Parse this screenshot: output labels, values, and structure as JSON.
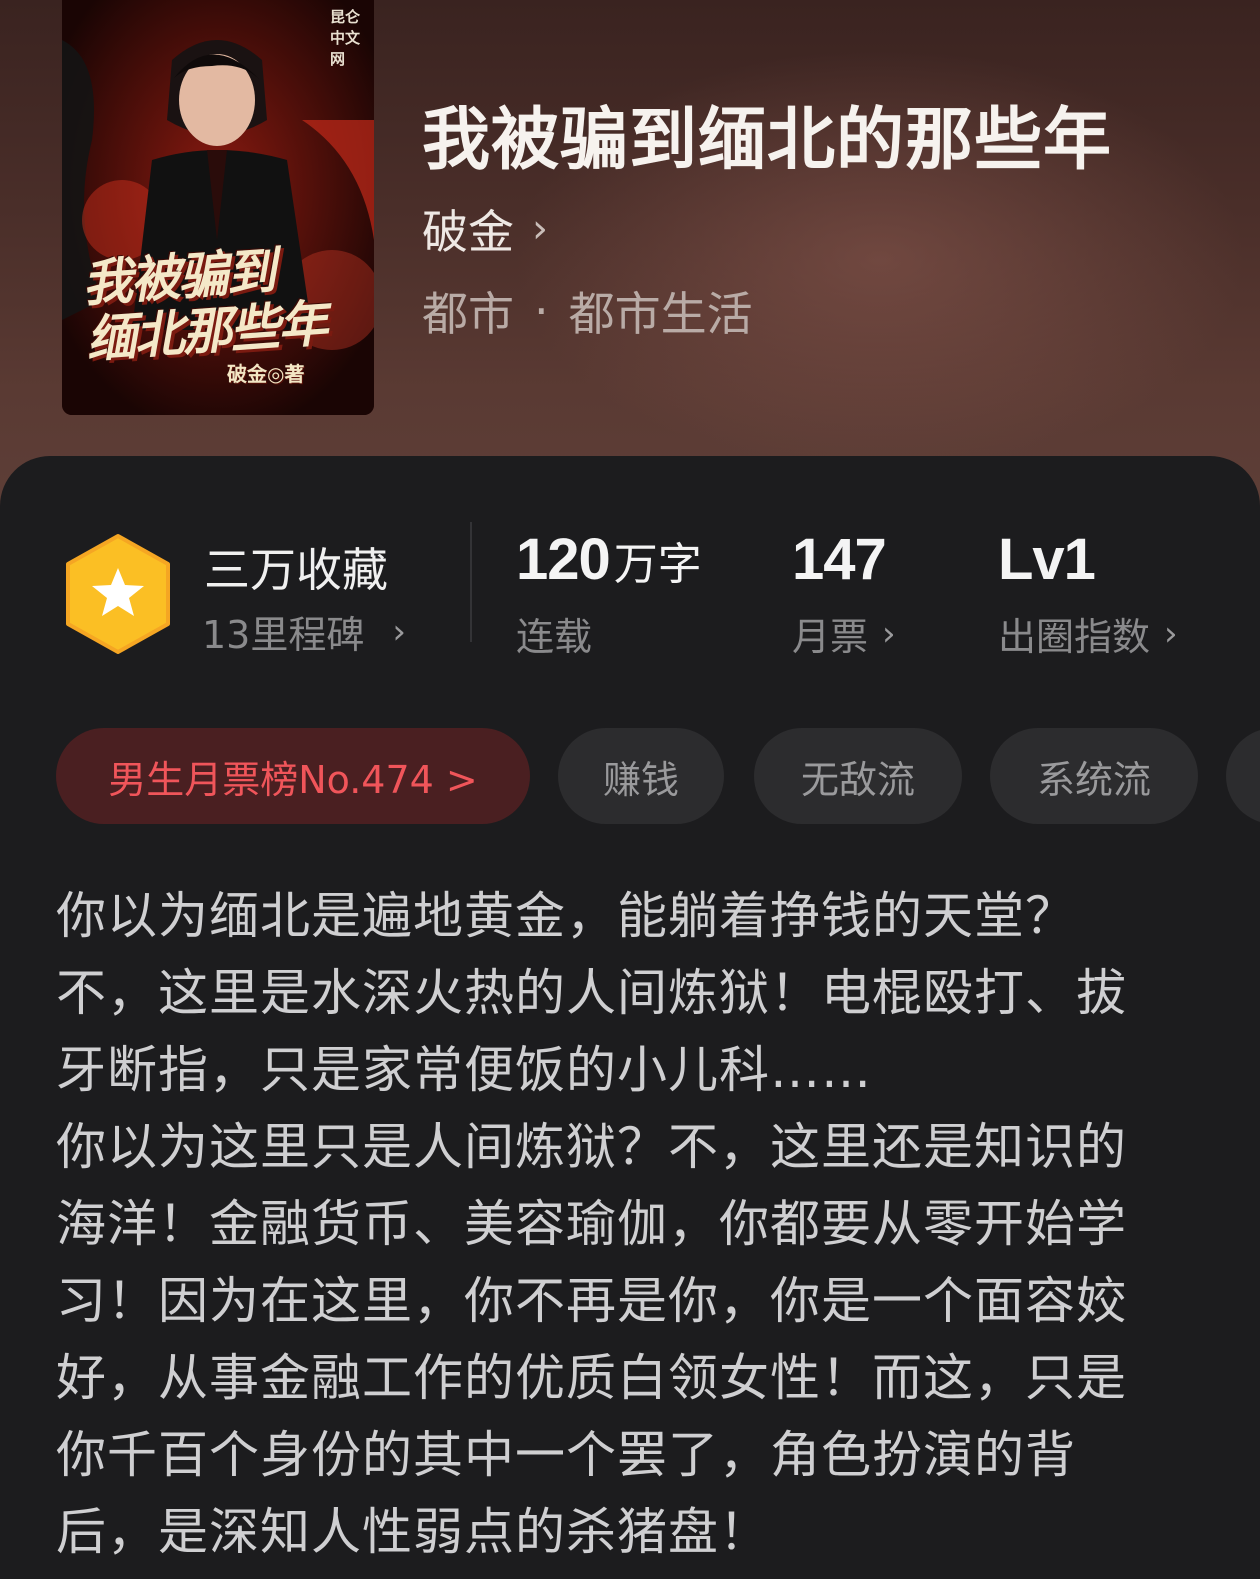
{
  "book": {
    "title": "我被骗到缅北的那些年",
    "author": "破金",
    "author_chevron": "›",
    "category": "都市",
    "genre_separator": "·",
    "subcategory": "都市生活"
  },
  "cover": {
    "publisher": "昆仑中文网",
    "title_line1": "我被骗到",
    "title_line2": "缅北那些年",
    "author_credit": "破金◎著"
  },
  "stats": {
    "collection": {
      "title": "三万收藏",
      "subtitle": "13里程碑",
      "chevron": "›",
      "badge_icon": "star-icon",
      "badge_color": "#fbbf24"
    },
    "word_count": {
      "number": "120",
      "unit": "万字",
      "label": "连载"
    },
    "monthly_votes": {
      "number": "147",
      "label": "月票",
      "chevron": "›"
    },
    "influence": {
      "number": "Lv1",
      "label": "出圈指数",
      "chevron": "›"
    }
  },
  "tags": {
    "rank": "男生月票榜No.474 >",
    "items": [
      "赚钱",
      "无敌流",
      "系统流"
    ]
  },
  "synopsis": "你以为缅北是遍地黄金，能躺着挣钱的天堂？\n不，这里是水深火热的人间炼狱！电棍殴打、拔\n牙断指，只是家常便饭的小儿科……\n你以为这里只是人间炼狱？不，这里还是知识的\n海洋！金融货币、美容瑜伽，你都要从零开始学\n习！因为在这里，你不再是你，你是一个面容姣\n好，从事金融工作的优质白领女性！而这，只是\n你千百个身份的其中一个罢了，角色扮演的背\n后，是深知人性弱点的杀猪盘！",
  "colors": {
    "rank_tag_text": "#f0555a",
    "rank_tag_bg": "#4a1f21",
    "panel_bg": "#1c1c1e"
  }
}
